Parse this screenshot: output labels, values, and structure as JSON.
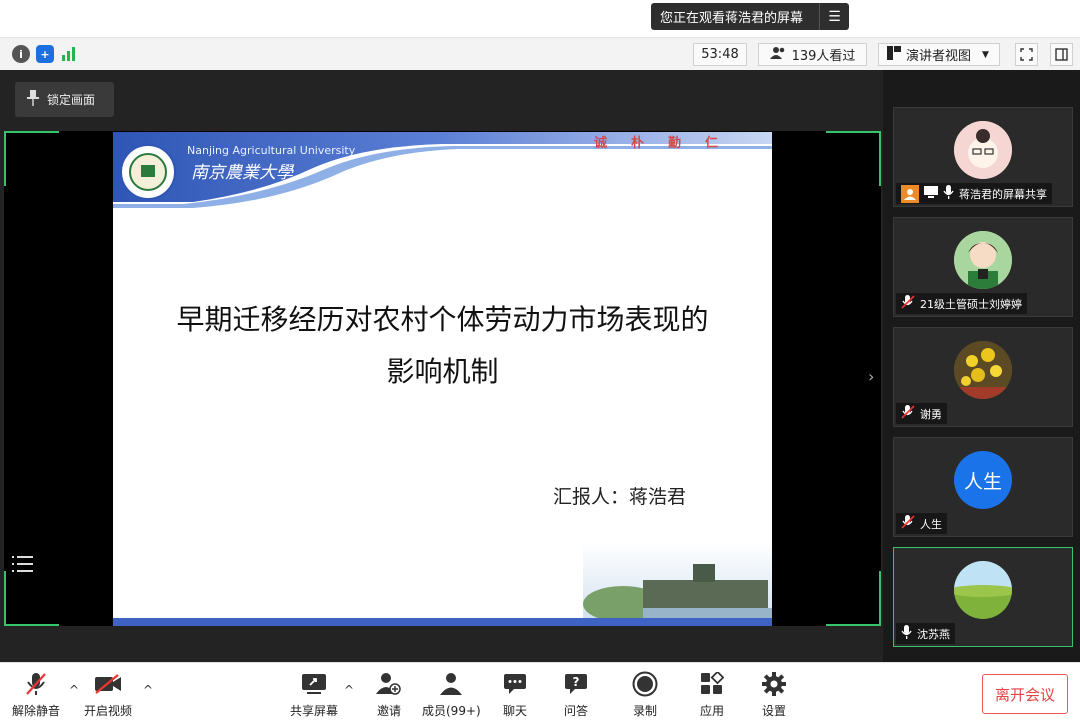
{
  "banner": {
    "text": "您正在观看蒋浩君的屏幕",
    "menu_icon": "list-menu-icon"
  },
  "status": {
    "timer": "53:48",
    "viewers": "139人看过",
    "view_mode": "演讲者视图",
    "icons": [
      "info-icon",
      "shield-icon",
      "signal-icon",
      "fullscreen-icon",
      "panel-toggle-icon"
    ]
  },
  "stage": {
    "lock_label": "锁定画面"
  },
  "slide": {
    "university_en": "Nanjing Agricultural University",
    "university_cn": "南京農業大學",
    "motto": "诚朴勤仁",
    "title_line1": "早期迁移经历对农村个体劳动力市场表现的",
    "title_line2": "影响机制",
    "reporter": "汇报人：蒋浩君"
  },
  "participants": [
    {
      "name": "蒋浩君的屏幕共享",
      "muted": false,
      "sharing": true,
      "active": false,
      "avatar": "cartoon-girl"
    },
    {
      "name": "21级土管硕士刘婷婷",
      "muted": true,
      "sharing": false,
      "active": false,
      "avatar": "cartoon-woman"
    },
    {
      "name": "谢勇",
      "muted": true,
      "sharing": false,
      "active": false,
      "avatar": "flowers"
    },
    {
      "name": "人生",
      "muted": true,
      "sharing": false,
      "active": false,
      "avatar_text": "人生"
    },
    {
      "name": "沈苏燕",
      "muted": false,
      "sharing": false,
      "active": true,
      "avatar": "landscape"
    }
  ],
  "toolbar": {
    "mute": "解除静音",
    "video": "开启视频",
    "share": "共享屏幕",
    "invite": "邀请",
    "members": "成员(99+)",
    "chat": "聊天",
    "qa": "问答",
    "record": "录制",
    "apps": "应用",
    "settings": "设置",
    "leave": "离开会议"
  },
  "colors": {
    "accent_green": "#35c46a",
    "leave_red": "#e54444",
    "avatar_blue": "#1a73e8",
    "motto_red": "#d24a4a"
  }
}
